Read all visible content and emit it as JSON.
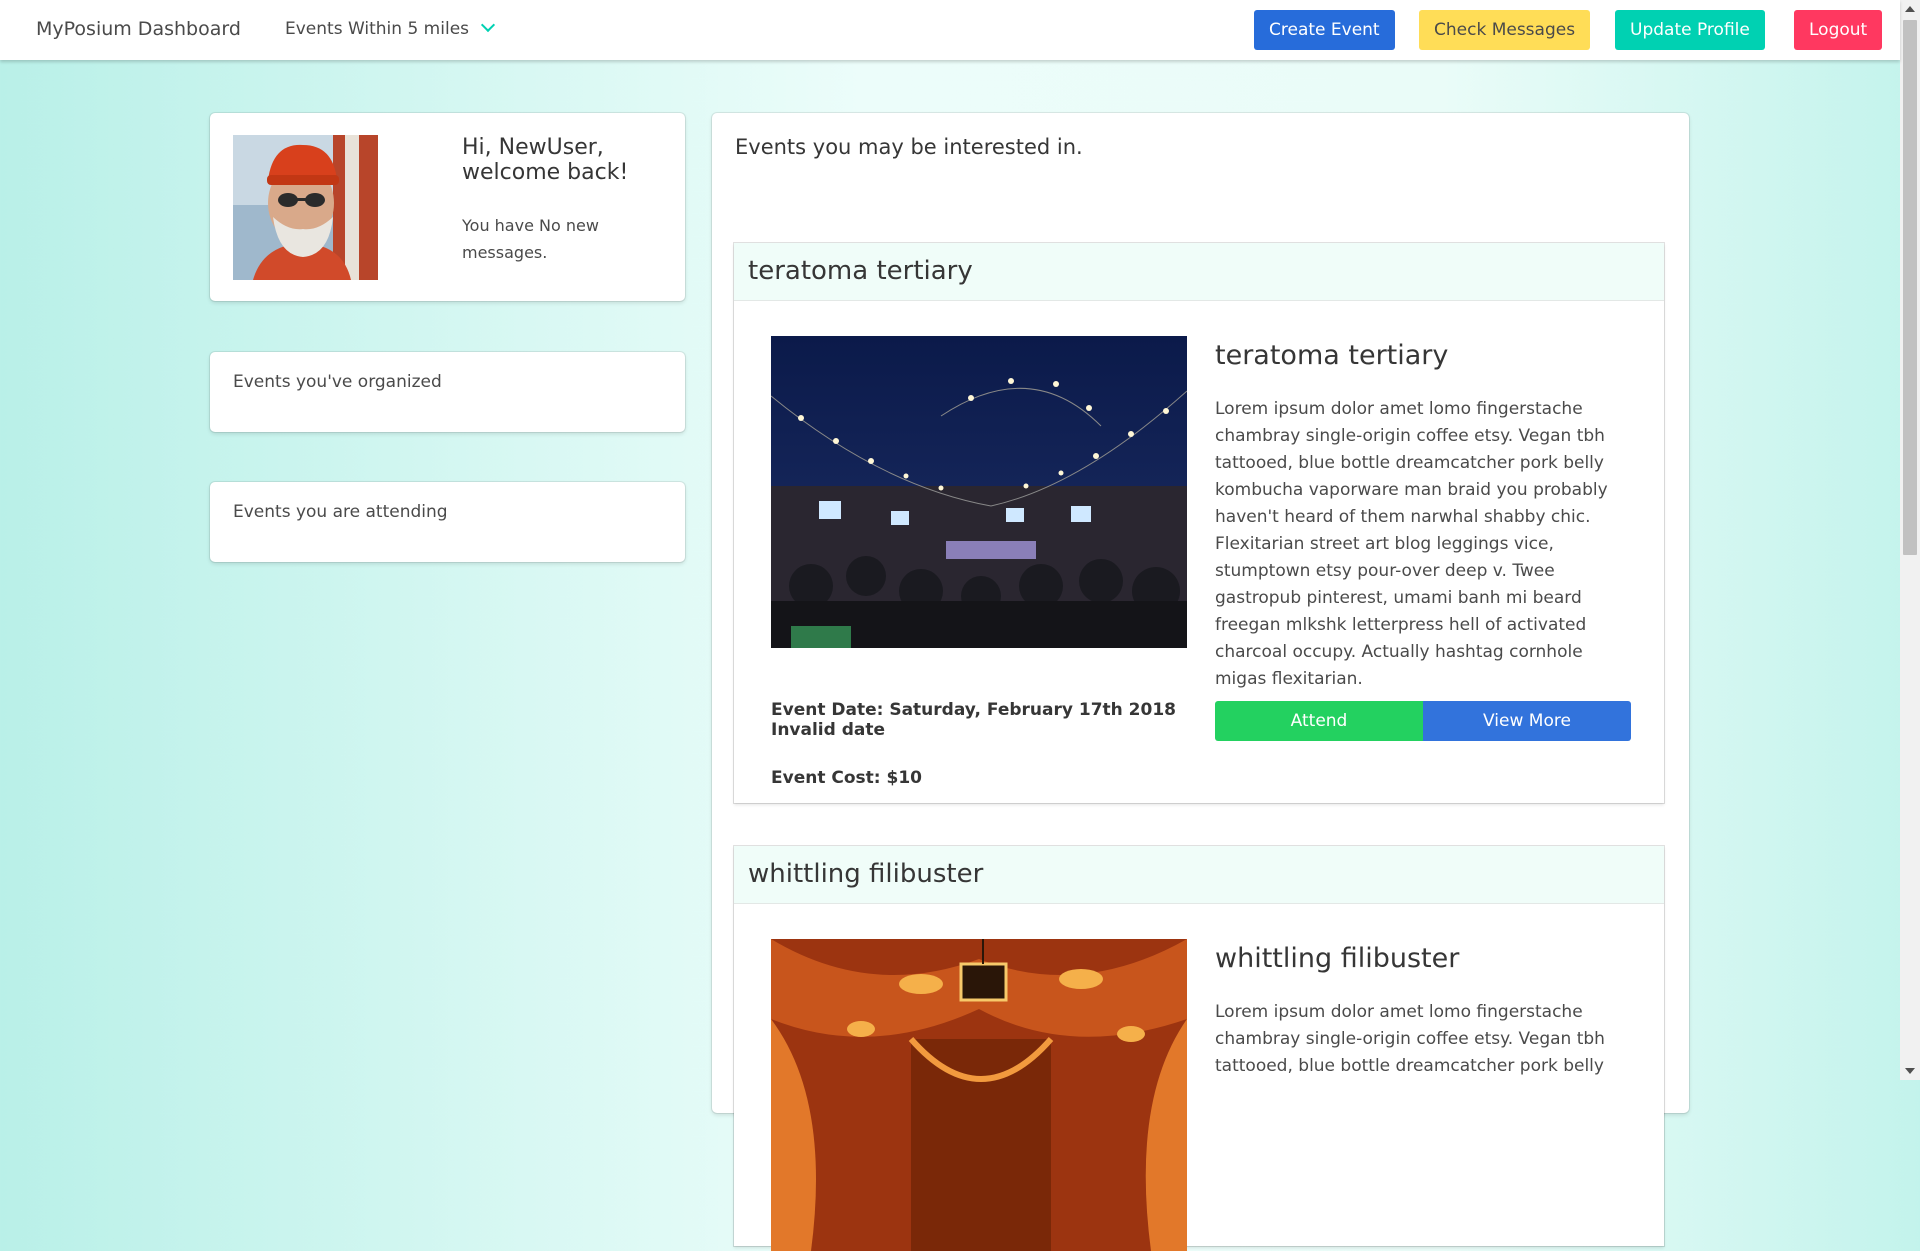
{
  "navbar": {
    "brand": "MyPosium Dashboard",
    "filter_label": "Events Within 5 miles",
    "buttons": {
      "create": "Create Event",
      "messages": "Check Messages",
      "profile": "Update Profile",
      "logout": "Logout"
    }
  },
  "profile": {
    "greeting": "Hi, NewUser, welcome back!",
    "messages": "You have No new messages."
  },
  "sidebar": {
    "organized": "Events you've organized",
    "attending": "Events you are attending"
  },
  "main": {
    "title": "Events you may be interested in.",
    "events": [
      {
        "header": "teratoma tertiary",
        "name": "teratoma tertiary",
        "description": "Lorem ipsum dolor amet lomo fingerstache chambray single-origin coffee etsy. Vegan tbh tattooed, blue bottle dreamcatcher pork belly kombucha vaporware man braid you probably haven't heard of them narwhal shabby chic. Flexitarian street art blog leggings vice, stumptown etsy pour-over deep v. Twee gastropub pinterest, umami banh mi beard freegan mlkshk letterpress hell of activated charcoal occupy. Actually hashtag cornhole migas flexitarian.",
        "date": "Event Date: Saturday, February 17th 2018 Invalid date",
        "cost": "Event Cost: $10",
        "attend_label": "Attend",
        "view_label": "View More"
      },
      {
        "header": "whittling filibuster",
        "name": "whittling filibuster",
        "description": "Lorem ipsum dolor amet lomo fingerstache chambray single-origin coffee etsy. Vegan tbh tattooed, blue bottle dreamcatcher pork belly"
      }
    ]
  },
  "colors": {
    "primary": "#276cda",
    "warning": "#ffdd57",
    "teal": "#00d1b2",
    "danger": "#ff3860",
    "success": "#23d160",
    "link": "#3273dc"
  }
}
